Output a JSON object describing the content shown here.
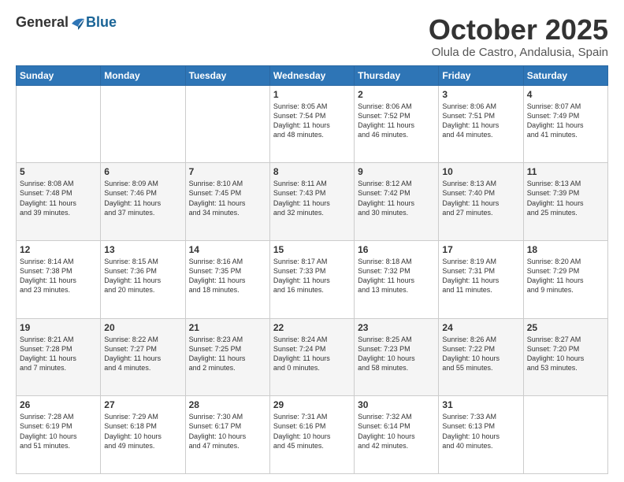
{
  "header": {
    "logo_general": "General",
    "logo_blue": "Blue",
    "month_title": "October 2025",
    "location": "Olula de Castro, Andalusia, Spain"
  },
  "weekdays": [
    "Sunday",
    "Monday",
    "Tuesday",
    "Wednesday",
    "Thursday",
    "Friday",
    "Saturday"
  ],
  "weeks": [
    [
      {
        "day": "",
        "info": ""
      },
      {
        "day": "",
        "info": ""
      },
      {
        "day": "",
        "info": ""
      },
      {
        "day": "1",
        "info": "Sunrise: 8:05 AM\nSunset: 7:54 PM\nDaylight: 11 hours\nand 48 minutes."
      },
      {
        "day": "2",
        "info": "Sunrise: 8:06 AM\nSunset: 7:52 PM\nDaylight: 11 hours\nand 46 minutes."
      },
      {
        "day": "3",
        "info": "Sunrise: 8:06 AM\nSunset: 7:51 PM\nDaylight: 11 hours\nand 44 minutes."
      },
      {
        "day": "4",
        "info": "Sunrise: 8:07 AM\nSunset: 7:49 PM\nDaylight: 11 hours\nand 41 minutes."
      }
    ],
    [
      {
        "day": "5",
        "info": "Sunrise: 8:08 AM\nSunset: 7:48 PM\nDaylight: 11 hours\nand 39 minutes."
      },
      {
        "day": "6",
        "info": "Sunrise: 8:09 AM\nSunset: 7:46 PM\nDaylight: 11 hours\nand 37 minutes."
      },
      {
        "day": "7",
        "info": "Sunrise: 8:10 AM\nSunset: 7:45 PM\nDaylight: 11 hours\nand 34 minutes."
      },
      {
        "day": "8",
        "info": "Sunrise: 8:11 AM\nSunset: 7:43 PM\nDaylight: 11 hours\nand 32 minutes."
      },
      {
        "day": "9",
        "info": "Sunrise: 8:12 AM\nSunset: 7:42 PM\nDaylight: 11 hours\nand 30 minutes."
      },
      {
        "day": "10",
        "info": "Sunrise: 8:13 AM\nSunset: 7:40 PM\nDaylight: 11 hours\nand 27 minutes."
      },
      {
        "day": "11",
        "info": "Sunrise: 8:13 AM\nSunset: 7:39 PM\nDaylight: 11 hours\nand 25 minutes."
      }
    ],
    [
      {
        "day": "12",
        "info": "Sunrise: 8:14 AM\nSunset: 7:38 PM\nDaylight: 11 hours\nand 23 minutes."
      },
      {
        "day": "13",
        "info": "Sunrise: 8:15 AM\nSunset: 7:36 PM\nDaylight: 11 hours\nand 20 minutes."
      },
      {
        "day": "14",
        "info": "Sunrise: 8:16 AM\nSunset: 7:35 PM\nDaylight: 11 hours\nand 18 minutes."
      },
      {
        "day": "15",
        "info": "Sunrise: 8:17 AM\nSunset: 7:33 PM\nDaylight: 11 hours\nand 16 minutes."
      },
      {
        "day": "16",
        "info": "Sunrise: 8:18 AM\nSunset: 7:32 PM\nDaylight: 11 hours\nand 13 minutes."
      },
      {
        "day": "17",
        "info": "Sunrise: 8:19 AM\nSunset: 7:31 PM\nDaylight: 11 hours\nand 11 minutes."
      },
      {
        "day": "18",
        "info": "Sunrise: 8:20 AM\nSunset: 7:29 PM\nDaylight: 11 hours\nand 9 minutes."
      }
    ],
    [
      {
        "day": "19",
        "info": "Sunrise: 8:21 AM\nSunset: 7:28 PM\nDaylight: 11 hours\nand 7 minutes."
      },
      {
        "day": "20",
        "info": "Sunrise: 8:22 AM\nSunset: 7:27 PM\nDaylight: 11 hours\nand 4 minutes."
      },
      {
        "day": "21",
        "info": "Sunrise: 8:23 AM\nSunset: 7:25 PM\nDaylight: 11 hours\nand 2 minutes."
      },
      {
        "day": "22",
        "info": "Sunrise: 8:24 AM\nSunset: 7:24 PM\nDaylight: 11 hours\nand 0 minutes."
      },
      {
        "day": "23",
        "info": "Sunrise: 8:25 AM\nSunset: 7:23 PM\nDaylight: 10 hours\nand 58 minutes."
      },
      {
        "day": "24",
        "info": "Sunrise: 8:26 AM\nSunset: 7:22 PM\nDaylight: 10 hours\nand 55 minutes."
      },
      {
        "day": "25",
        "info": "Sunrise: 8:27 AM\nSunset: 7:20 PM\nDaylight: 10 hours\nand 53 minutes."
      }
    ],
    [
      {
        "day": "26",
        "info": "Sunrise: 7:28 AM\nSunset: 6:19 PM\nDaylight: 10 hours\nand 51 minutes."
      },
      {
        "day": "27",
        "info": "Sunrise: 7:29 AM\nSunset: 6:18 PM\nDaylight: 10 hours\nand 49 minutes."
      },
      {
        "day": "28",
        "info": "Sunrise: 7:30 AM\nSunset: 6:17 PM\nDaylight: 10 hours\nand 47 minutes."
      },
      {
        "day": "29",
        "info": "Sunrise: 7:31 AM\nSunset: 6:16 PM\nDaylight: 10 hours\nand 45 minutes."
      },
      {
        "day": "30",
        "info": "Sunrise: 7:32 AM\nSunset: 6:14 PM\nDaylight: 10 hours\nand 42 minutes."
      },
      {
        "day": "31",
        "info": "Sunrise: 7:33 AM\nSunset: 6:13 PM\nDaylight: 10 hours\nand 40 minutes."
      },
      {
        "day": "",
        "info": ""
      }
    ]
  ]
}
